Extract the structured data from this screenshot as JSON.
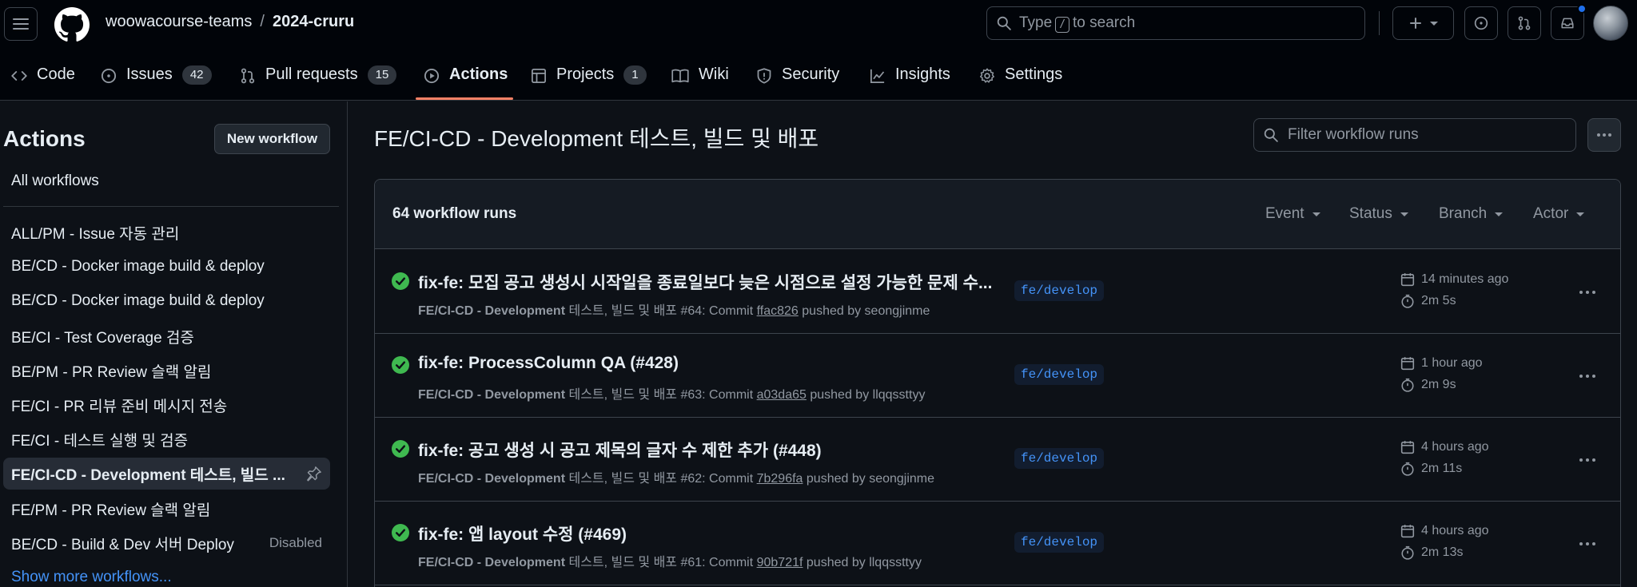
{
  "header": {
    "owner": "woowacourse-teams",
    "separator": "/",
    "repo": "2024-cruru",
    "search": {
      "prefix": "Type",
      "key": "/",
      "suffix": "to search"
    }
  },
  "repo_tabs": [
    {
      "label": "Code"
    },
    {
      "label": "Issues",
      "count": "42"
    },
    {
      "label": "Pull requests",
      "count": "15"
    },
    {
      "label": "Actions"
    },
    {
      "label": "Projects",
      "count": "1"
    },
    {
      "label": "Wiki"
    },
    {
      "label": "Security"
    },
    {
      "label": "Insights"
    },
    {
      "label": "Settings"
    }
  ],
  "sidebar": {
    "title": "Actions",
    "new_workflow_label": "New workflow",
    "all_workflows": "All workflows",
    "items": [
      {
        "label": "ALL/PM - Issue 자동 관리"
      },
      {
        "label": "BE/CD - Docker image build & deploy"
      },
      {
        "label": "BE/CD - Docker image build & deploy"
      },
      {
        "label": "BE/CI - Test Coverage 검증"
      },
      {
        "label": "BE/PM - PR Review 슬랙 알림"
      },
      {
        "label": "FE/CI - PR 리뷰 준비 메시지 전송"
      },
      {
        "label": "FE/CI - 테스트 실행 및 검증"
      },
      {
        "label": "FE/CI-CD - Development 테스트, 빌드 ..."
      },
      {
        "label": "FE/PM - PR Review 슬랙 알림"
      },
      {
        "label": "BE/CD - Build & Dev 서버 Deploy",
        "badge": "Disabled"
      }
    ],
    "show_more": "Show more workflows..."
  },
  "main": {
    "title": "FE/CI-CD - Development 테스트, 빌드 및 배포",
    "filter_placeholder": "Filter workflow runs",
    "run_count": "64 workflow runs",
    "filters": [
      "Event",
      "Status",
      "Branch",
      "Actor"
    ],
    "runs": [
      {
        "title": "fix-fe: 모집 공고 생성시 시작일을 종료일보다 늦은 시점으로 설정 가능한 문제 수...",
        "workflow": "FE/CI-CD - Development",
        "workflow_suffix": "테스트, 빌드 및 배포 #64: Commit",
        "sha": "ffac826",
        "by": "pushed by seongjinme",
        "branch": "fe/develop",
        "when": "14 minutes ago",
        "duration": "2m 5s"
      },
      {
        "title": "fix-fe: ProcessColumn QA (#428)",
        "workflow": "FE/CI-CD - Development",
        "workflow_suffix": "테스트, 빌드 및 배포 #63: Commit",
        "sha": "a03da65",
        "by": "pushed by llqqssttyy",
        "branch": "fe/develop",
        "when": "1 hour ago",
        "duration": "2m 9s"
      },
      {
        "title": "fix-fe: 공고 생성 시 공고 제목의 글자 수 제한 추가 (#448)",
        "workflow": "FE/CI-CD - Development",
        "workflow_suffix": "테스트, 빌드 및 배포 #62: Commit",
        "sha": "7b296fa",
        "by": "pushed by seongjinme",
        "branch": "fe/develop",
        "when": "4 hours ago",
        "duration": "2m 11s"
      },
      {
        "title": "fix-fe: 앱 layout 수정 (#469)",
        "workflow": "FE/CI-CD - Development",
        "workflow_suffix": "테스트, 빌드 및 배포 #61: Commit",
        "sha": "90b721f",
        "by": "pushed by llqqssttyy",
        "branch": "fe/develop",
        "when": "4 hours ago",
        "duration": "2m 13s"
      }
    ]
  },
  "colors": {
    "background": "#0d1117",
    "header_bg": "#010409",
    "accent_underline": "#f78166",
    "success": "#3fb950",
    "link": "#4493f8"
  },
  "icons": [
    "hamburger-icon",
    "github-logo",
    "search-icon",
    "plus-icon",
    "issue-icon",
    "pr-icon",
    "inbox-icon",
    "code-icon",
    "play-icon",
    "table-icon",
    "book-icon",
    "shield-icon",
    "graph-icon",
    "gear-icon",
    "pin-icon",
    "check-circle-icon",
    "calendar-icon",
    "stopwatch-icon",
    "kebab-icon"
  ]
}
